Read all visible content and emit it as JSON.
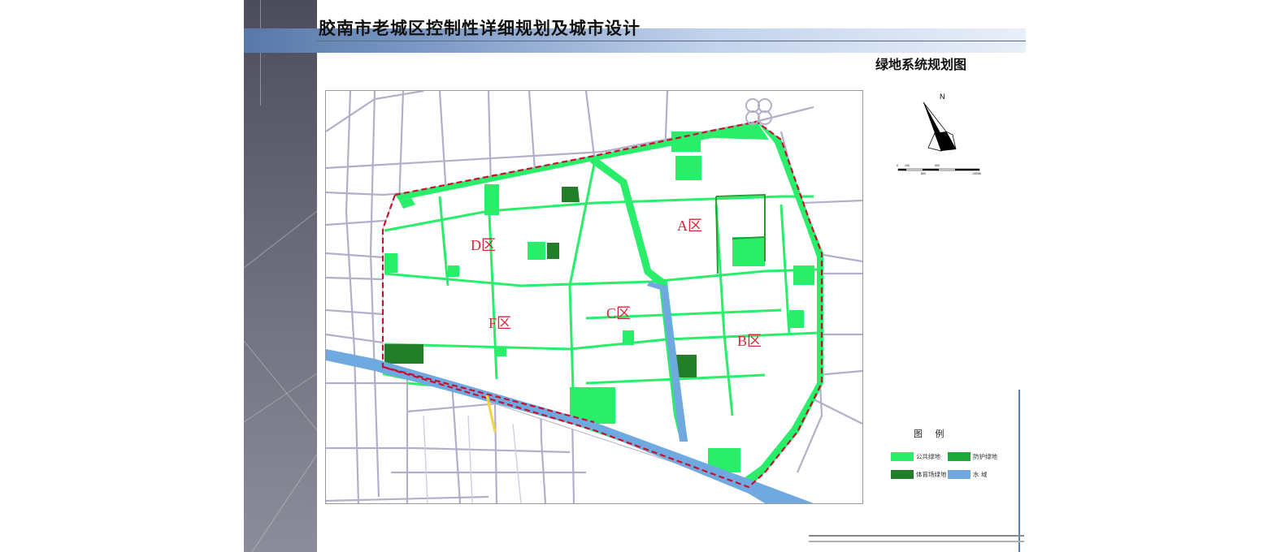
{
  "header": {
    "title": "胶南市老城区控制性详细规划及城市设计",
    "subtitle": "绿地系统规划图"
  },
  "map": {
    "zones": [
      {
        "id": "A",
        "label": "A区"
      },
      {
        "id": "B",
        "label": "B区"
      },
      {
        "id": "C",
        "label": "C区"
      },
      {
        "id": "D",
        "label": "D区"
      },
      {
        "id": "F",
        "label": "F区"
      }
    ],
    "colors": {
      "public_green": "#29ee6a",
      "protective_green": "#2a9a32",
      "sports_green": "#237e2a",
      "water": "#6fa9e0",
      "boundary": "#c8102e",
      "road": "#b4aec8"
    }
  },
  "compass": {
    "north_label": "N"
  },
  "scale": {
    "labels": [
      "0",
      "100",
      "500",
      "800",
      "1000M"
    ]
  },
  "legend": {
    "title": "图 例",
    "items": [
      {
        "label": "公共绿地",
        "color": "#29ee6a"
      },
      {
        "label": "防护绿地",
        "color": "#1fa83a"
      },
      {
        "label": "体育场绿地",
        "color": "#237e2a"
      },
      {
        "label": "水  域",
        "color": "#6fa9e0"
      }
    ]
  }
}
